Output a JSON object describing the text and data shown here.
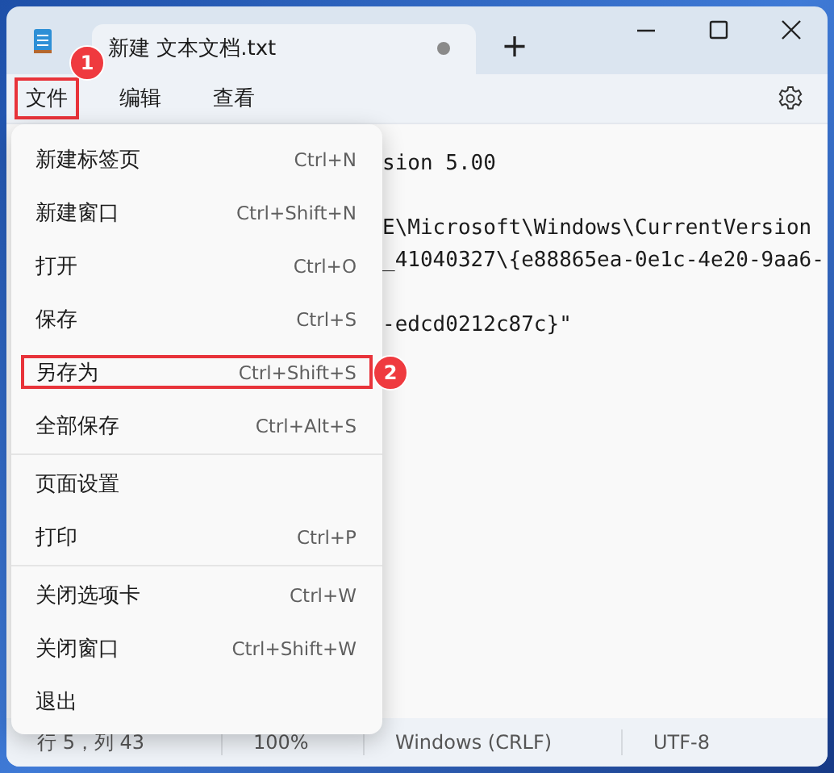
{
  "window": {
    "tab": {
      "label": "新建 文本文档.txt",
      "modified": true,
      "selected": true
    },
    "new_tab": "+"
  },
  "menu_bar": [
    {
      "label": "文件",
      "callout": "1"
    },
    {
      "label": "编辑"
    },
    {
      "label": "查看"
    }
  ],
  "editor": {
    "text": "sion 5.00\n\nE\\Microsoft\\Windows\\CurrentVersion\n_41040327\\{e88865ea-0e1c-4e20-9aa6-\n\n-edcd0212c87c}\""
  },
  "file_menu": {
    "groups": [
      {
        "items": [
          {
            "label": "新建标签页",
            "shortcut": "Ctrl+N"
          },
          {
            "label": "新建窗口",
            "shortcut": "Ctrl+Shift+N"
          },
          {
            "label": "打开",
            "shortcut": "Ctrl+O"
          },
          {
            "label": "保存",
            "shortcut": "Ctrl+S"
          },
          {
            "label": "另存为",
            "shortcut": "Ctrl+Shift+S",
            "callout": "2"
          },
          {
            "label": "全部保存",
            "shortcut": "Ctrl+Alt+S"
          }
        ]
      },
      {
        "items": [
          {
            "label": "页面设置"
          },
          {
            "label": "打印",
            "shortcut": "Ctrl+P"
          }
        ]
      },
      {
        "items": [
          {
            "label": "关闭选项卡",
            "shortcut": "Ctrl+W"
          },
          {
            "label": "关闭窗口",
            "shortcut": "Ctrl+Shift+W"
          },
          {
            "label": "退出"
          }
        ]
      }
    ]
  },
  "status_bar": [
    "行 5，列 43",
    "100%",
    "Windows (CRLF)",
    "UTF-8"
  ]
}
